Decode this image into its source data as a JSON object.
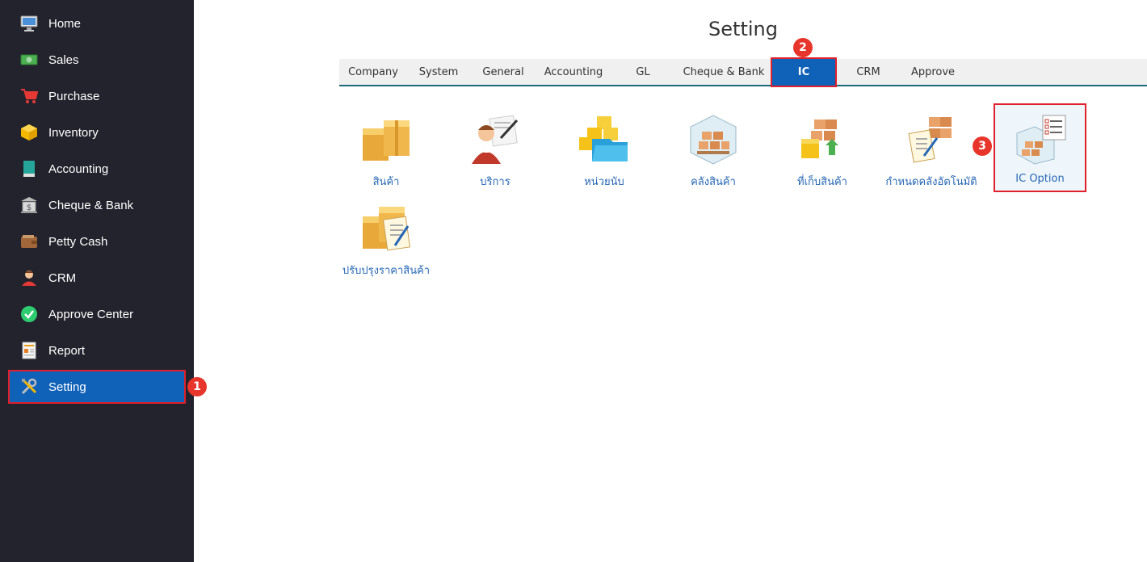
{
  "sidebar": {
    "items": [
      {
        "label": "Home",
        "icon": "monitor-icon"
      },
      {
        "label": "Sales",
        "icon": "money-icon"
      },
      {
        "label": "Purchase",
        "icon": "cart-icon"
      },
      {
        "label": "Inventory",
        "icon": "box-icon"
      },
      {
        "label": "Accounting",
        "icon": "book-icon"
      },
      {
        "label": "Cheque & Bank",
        "icon": "bank-icon"
      },
      {
        "label": "Petty Cash",
        "icon": "wallet-icon"
      },
      {
        "label": "CRM",
        "icon": "person-icon"
      },
      {
        "label": "Approve Center",
        "icon": "check-icon"
      },
      {
        "label": "Report",
        "icon": "report-icon"
      },
      {
        "label": "Setting",
        "icon": "tools-icon"
      }
    ],
    "active": "Setting"
  },
  "badges": {
    "one": "1",
    "two": "2",
    "three": "3"
  },
  "page": {
    "title": "Setting"
  },
  "tabs": [
    {
      "label": "Company"
    },
    {
      "label": "System"
    },
    {
      "label": "General"
    },
    {
      "label": "Accounting"
    },
    {
      "label": "GL"
    },
    {
      "label": "Cheque & Bank"
    },
    {
      "label": "IC"
    },
    {
      "label": "CRM"
    },
    {
      "label": "Approve"
    }
  ],
  "active_tab": "IC",
  "tiles": [
    {
      "label": "สินค้า",
      "icon": "product-boxes-icon"
    },
    {
      "label": "บริการ",
      "icon": "service-person-icon"
    },
    {
      "label": "หน่วยนับ",
      "icon": "unit-folder-icon"
    },
    {
      "label": "คลังสินค้า",
      "icon": "warehouse-icon"
    },
    {
      "label": "ที่เก็บสินค้า",
      "icon": "storage-location-icon"
    },
    {
      "label": "กำหนดคลังอัตโนมัติ",
      "icon": "auto-warehouse-icon"
    },
    {
      "label": "IC Option",
      "icon": "ic-option-checklist-icon"
    },
    {
      "label": "ปรับปรุงราคาสินค้า",
      "icon": "price-adjust-icon"
    }
  ],
  "colors": {
    "sidebar_bg": "#23232d",
    "active_blue": "#1061b8",
    "highlight_red": "#e0202b",
    "link_blue": "#2767b3"
  }
}
